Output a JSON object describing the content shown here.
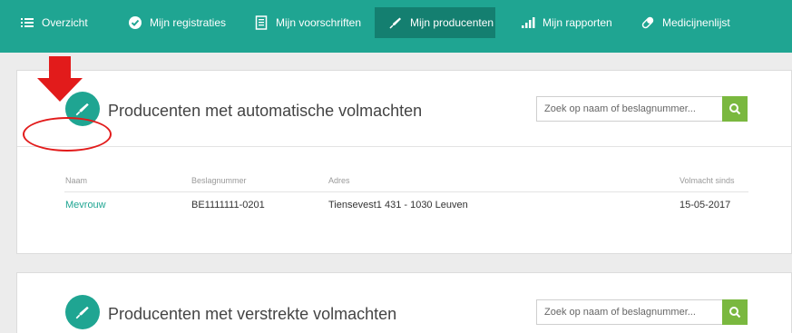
{
  "nav": {
    "items": [
      {
        "label": "Overzicht",
        "icon": "list-icon"
      },
      {
        "label": "Mijn registraties",
        "icon": "check-circle-icon"
      },
      {
        "label": "Mijn voorschriften",
        "icon": "document-icon"
      },
      {
        "label": "Mijn producenten",
        "icon": "syringe-icon",
        "active": true
      },
      {
        "label": "Mijn rapporten",
        "icon": "bar-chart-icon"
      },
      {
        "label": "Medicijnenlijst",
        "icon": "pill-icon"
      }
    ]
  },
  "panels": [
    {
      "title": "Producenten met automatische volmachten",
      "icon": "syringe-icon",
      "search": {
        "placeholder": "Zoek op naam of beslagnummer..."
      },
      "table": {
        "columns": [
          "Naam",
          "Beslagnummer",
          "Adres",
          "Volmacht sinds"
        ],
        "rows": [
          {
            "naam": "Mevrouw",
            "beslagnummer": "BE1111111-0201",
            "adres": "Tiensevest1 431 - 1030 Leuven",
            "volmacht_sinds": "15-05-2017"
          }
        ]
      }
    },
    {
      "title": "Producenten met verstrekte volmachten",
      "icon": "syringe-icon",
      "search": {
        "placeholder": "Zoek op naam of beslagnummer..."
      }
    }
  ],
  "annotations": {
    "highlight_color": "#e21b1b"
  },
  "colors": {
    "brand": "#1fa592",
    "brand_dark": "#147f70",
    "search_button": "#7ab83f"
  }
}
